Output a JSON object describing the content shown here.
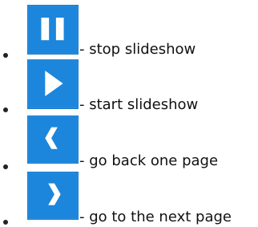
{
  "colors": {
    "button_blue": "#1c86dc",
    "icon_white": "#ffffff",
    "text": "#111111"
  },
  "legend": [
    {
      "icon": "pause-icon",
      "text": "- stop slideshow"
    },
    {
      "icon": "play-icon",
      "text": "- start slideshow"
    },
    {
      "icon": "chevron-left-icon",
      "text": "- go back one page"
    },
    {
      "icon": "chevron-right-icon",
      "text": "- go to the next page"
    }
  ]
}
